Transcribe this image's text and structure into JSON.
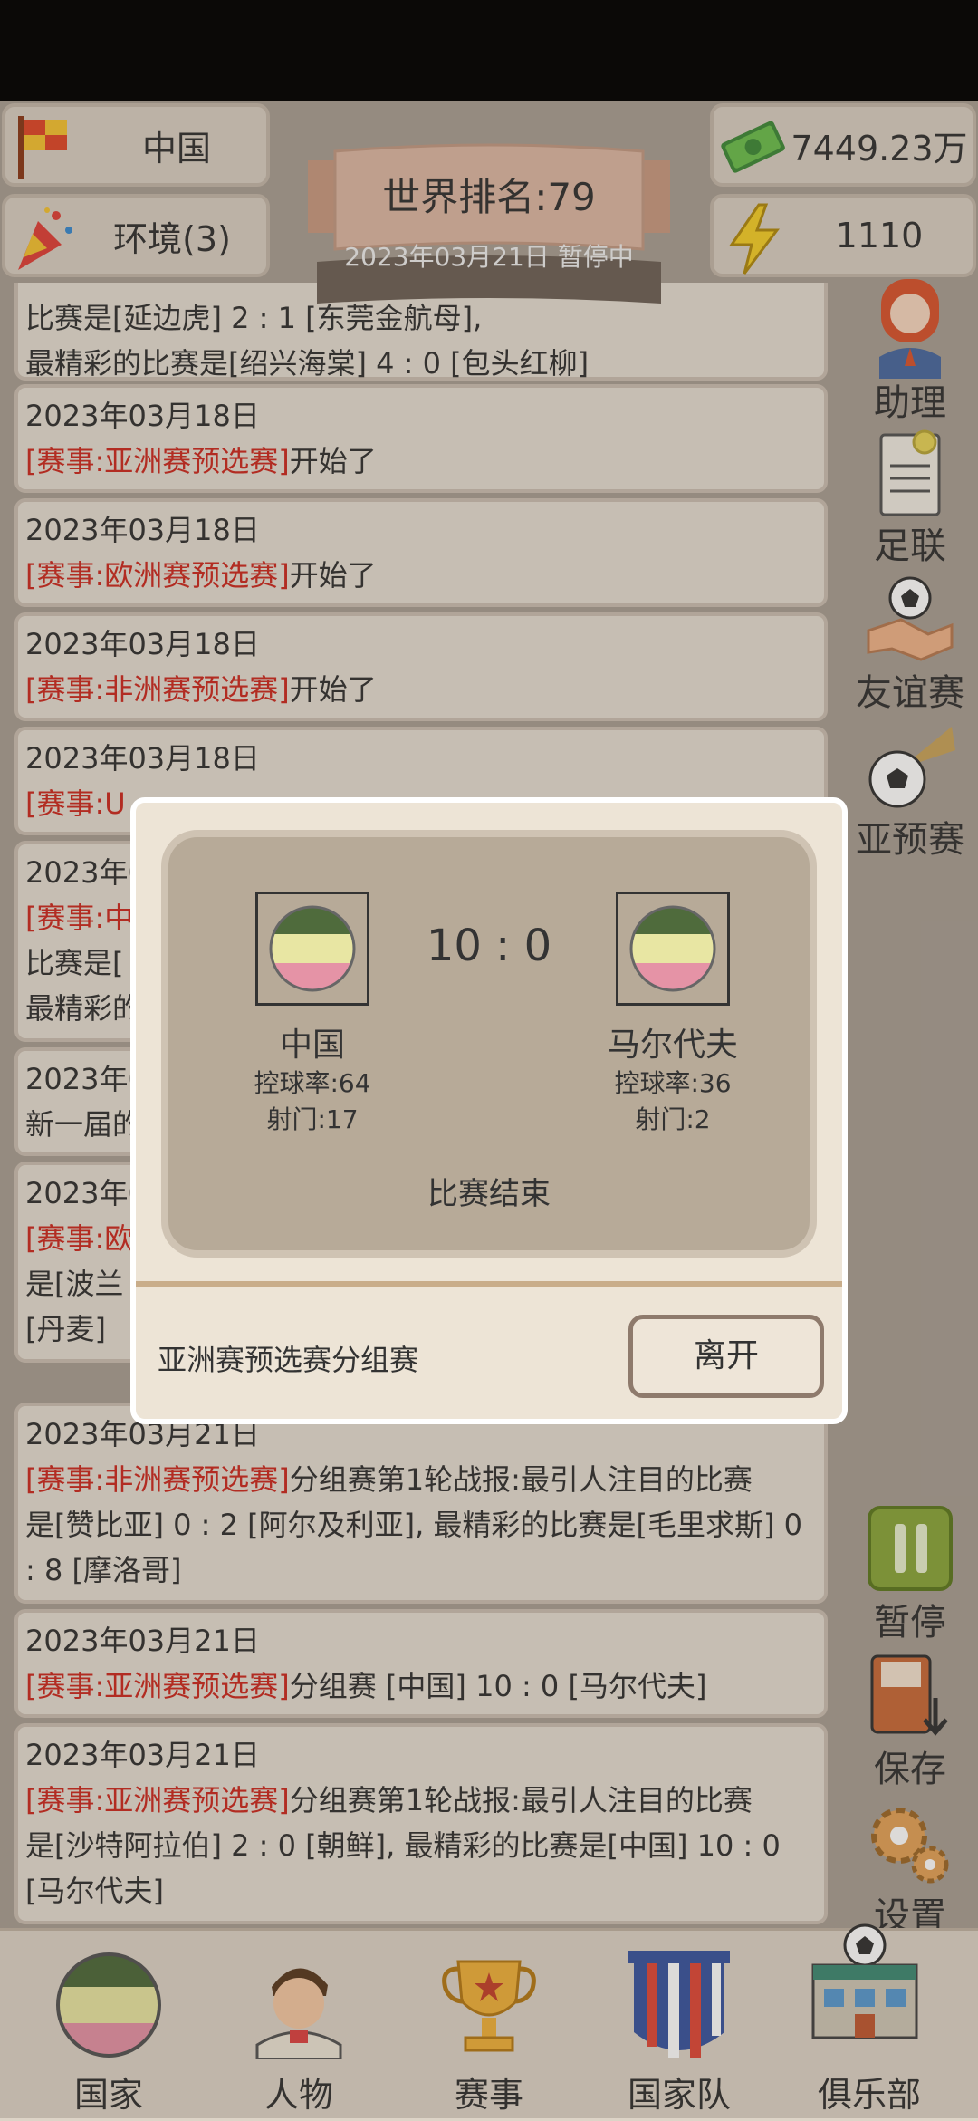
{
  "top": {
    "country": "中国",
    "environment": "环境(3)",
    "money": "7449.23万",
    "energy": "1110",
    "world_rank": "世界排名:79",
    "date_status": "2023年03月21日 暂停中"
  },
  "log": [
    {
      "date": "",
      "tag": "",
      "text": "比赛是[延边虎] 2 : 1 [东莞金航母],"
    },
    {
      "date": "2023年03月18日",
      "tag": "[赛事:亚洲赛预选赛]",
      "text": "开始了"
    },
    {
      "date": "2023年03月18日",
      "tag": "[赛事:欧洲赛预选赛]",
      "text": "开始了"
    },
    {
      "date": "2023年03月18日",
      "tag": "[赛事:非洲赛预选赛]",
      "text": "开始了"
    },
    {
      "date": "2023年03月18日",
      "tag": "[赛事:U",
      "text": ""
    },
    {
      "date": "2023年0",
      "tag": "[赛事:中",
      "text": ""
    },
    {
      "date": "2023年0",
      "tag": "",
      "text": "新一届的"
    },
    {
      "date": "2023年0",
      "tag": "[赛事:欧",
      "text": ""
    },
    {
      "date": "2023年03月21日",
      "tag": "[赛事:非洲赛预选赛]",
      "text": "分组赛第1轮战报:最引人注目的比赛"
    },
    {
      "date": "2023年03月21日",
      "tag": "[赛事:亚洲赛预选赛]",
      "text": "分组赛 [中国] 10 : 0 [马尔代夫]"
    },
    {
      "date": "2023年03月21日",
      "tag": "[赛事:亚洲赛预选赛]",
      "text": "分组赛第1轮战报:最引人注目的比赛"
    }
  ],
  "log_extra": {
    "l0b": "最精彩的比赛是[绍兴海棠] 4 : 0 [包头红柳]",
    "l5b": "比赛是[",
    "l5c": "最精彩的",
    "l7b": "是[波兰",
    "l7c": "[丹麦]",
    "l8b": "是[赞比亚] 0 : 2 [阿尔及利亚], 最精彩的比赛是[毛里求斯] 0",
    "l8c": ": 8 [摩洛哥]",
    "l10b": "是[沙特阿拉伯] 2 : 0 [朝鲜], 最精彩的比赛是[中国] 10 : 0",
    "l10c": "[马尔代夫]"
  },
  "side": {
    "assistant": "助理",
    "fa": "足联",
    "friendly": "友谊赛",
    "qualifier": "亚预赛",
    "pause": "暂停",
    "save": "保存",
    "settings": "设置"
  },
  "nav": {
    "country": "国家",
    "people": "人物",
    "events": "赛事",
    "national_team": "国家队",
    "club": "俱乐部"
  },
  "modal": {
    "score": "10 : 0",
    "home_name": "中国",
    "home_possession": "控球率:64",
    "home_shots": "射门:17",
    "away_name": "马尔代夫",
    "away_possession": "控球率:36",
    "away_shots": "射门:2",
    "status": "比赛结束",
    "match_type": "亚洲赛预选赛分组赛",
    "leave": "离开"
  },
  "colors": {
    "flag_stripe_top": "#4f6b3c",
    "flag_stripe_mid": "#e8e6a3",
    "flag_stripe_bottom": "#e593a6",
    "tag_red": "#cc2b22"
  }
}
